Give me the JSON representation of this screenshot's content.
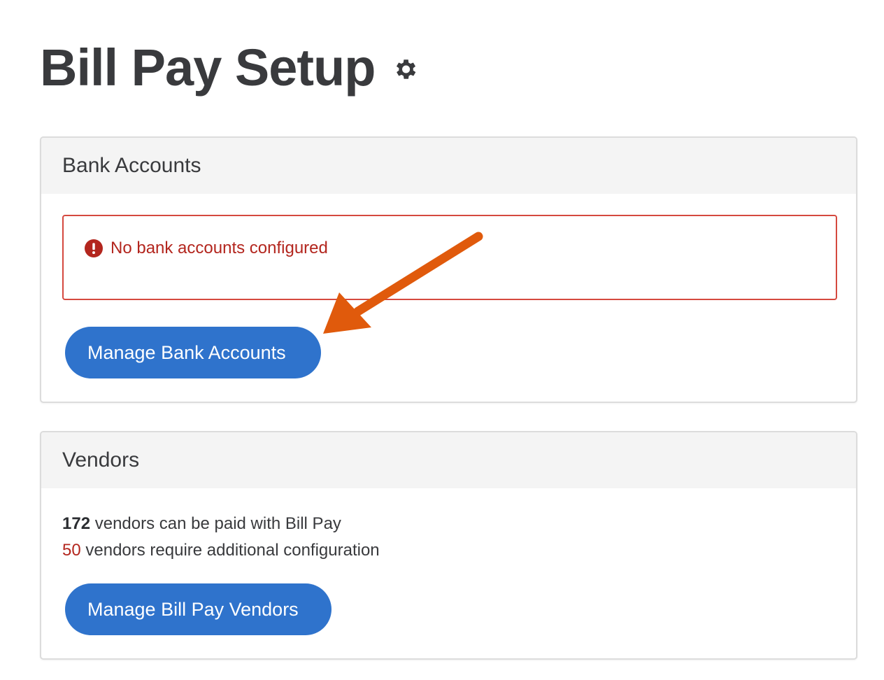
{
  "page": {
    "title": "Bill Pay Setup",
    "settings_icon": "gear-icon"
  },
  "bank_accounts": {
    "header": "Bank Accounts",
    "alert": {
      "icon": "error-icon",
      "text": "No bank accounts configured",
      "color": "#b3261e"
    },
    "button_label": "Manage Bank Accounts"
  },
  "vendors": {
    "header": "Vendors",
    "payable_count": "172",
    "payable_text": " vendors can be paid with Bill Pay",
    "needs_config_count": "50",
    "needs_config_text": " vendors require additional configuration",
    "button_label": "Manage Bill Pay Vendors"
  },
  "colors": {
    "primary_button": "#2f73cc",
    "error": "#b3261e",
    "annotation_arrow": "#e05a0c"
  }
}
